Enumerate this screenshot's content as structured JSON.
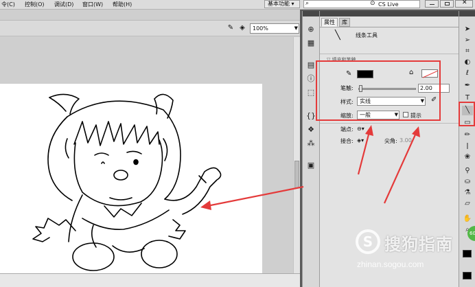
{
  "menubar": {
    "items": [
      "令(C)",
      "控制(O)",
      "调试(D)",
      "窗口(W)",
      "帮助(H)"
    ],
    "workspace": "基本功能 ▾",
    "search_label": "CS Live"
  },
  "stage": {
    "zoom": "100%"
  },
  "panel": {
    "tabs": [
      "属性",
      "库"
    ],
    "tool_name": "线条工具",
    "section": "▽ 填充和笔触",
    "stroke_label": "笔触:",
    "stroke_value": "2.00",
    "style_label": "样式:",
    "style_value": "实线",
    "scale_label": "缩放:",
    "scale_value": "一般",
    "hint_label": "提示",
    "cap_label": "端点:",
    "join_label": "接合:",
    "miter_label": "尖角:",
    "miter_value": "3.00"
  },
  "colors": {
    "stroke_color": "#000000",
    "annotation_red": "#e43a3a"
  },
  "watermark": {
    "logo": "S",
    "text": "搜狗指南",
    "url": "zhinan.sogou.com",
    "badge": "60"
  },
  "icons": {
    "dock": [
      "transform-icon",
      "align-icon",
      "info-icon",
      "swatches-icon",
      "motion-presets-icon",
      "components-icon",
      "movie-explorer-icon",
      "code-snippets-icon"
    ],
    "toolbox": [
      "selection-tool-icon",
      "subselection-tool-icon",
      "free-transform-icon",
      "3d-rotation-icon",
      "lasso-icon",
      "pen-icon",
      "text-icon",
      "line-tool-icon",
      "rectangle-icon",
      "pencil-icon",
      "brush-icon",
      "deco-icon",
      "bone-icon",
      "paint-bucket-icon",
      "eyedropper-icon",
      "eraser-icon",
      "hand-icon",
      "zoom-icon"
    ]
  }
}
